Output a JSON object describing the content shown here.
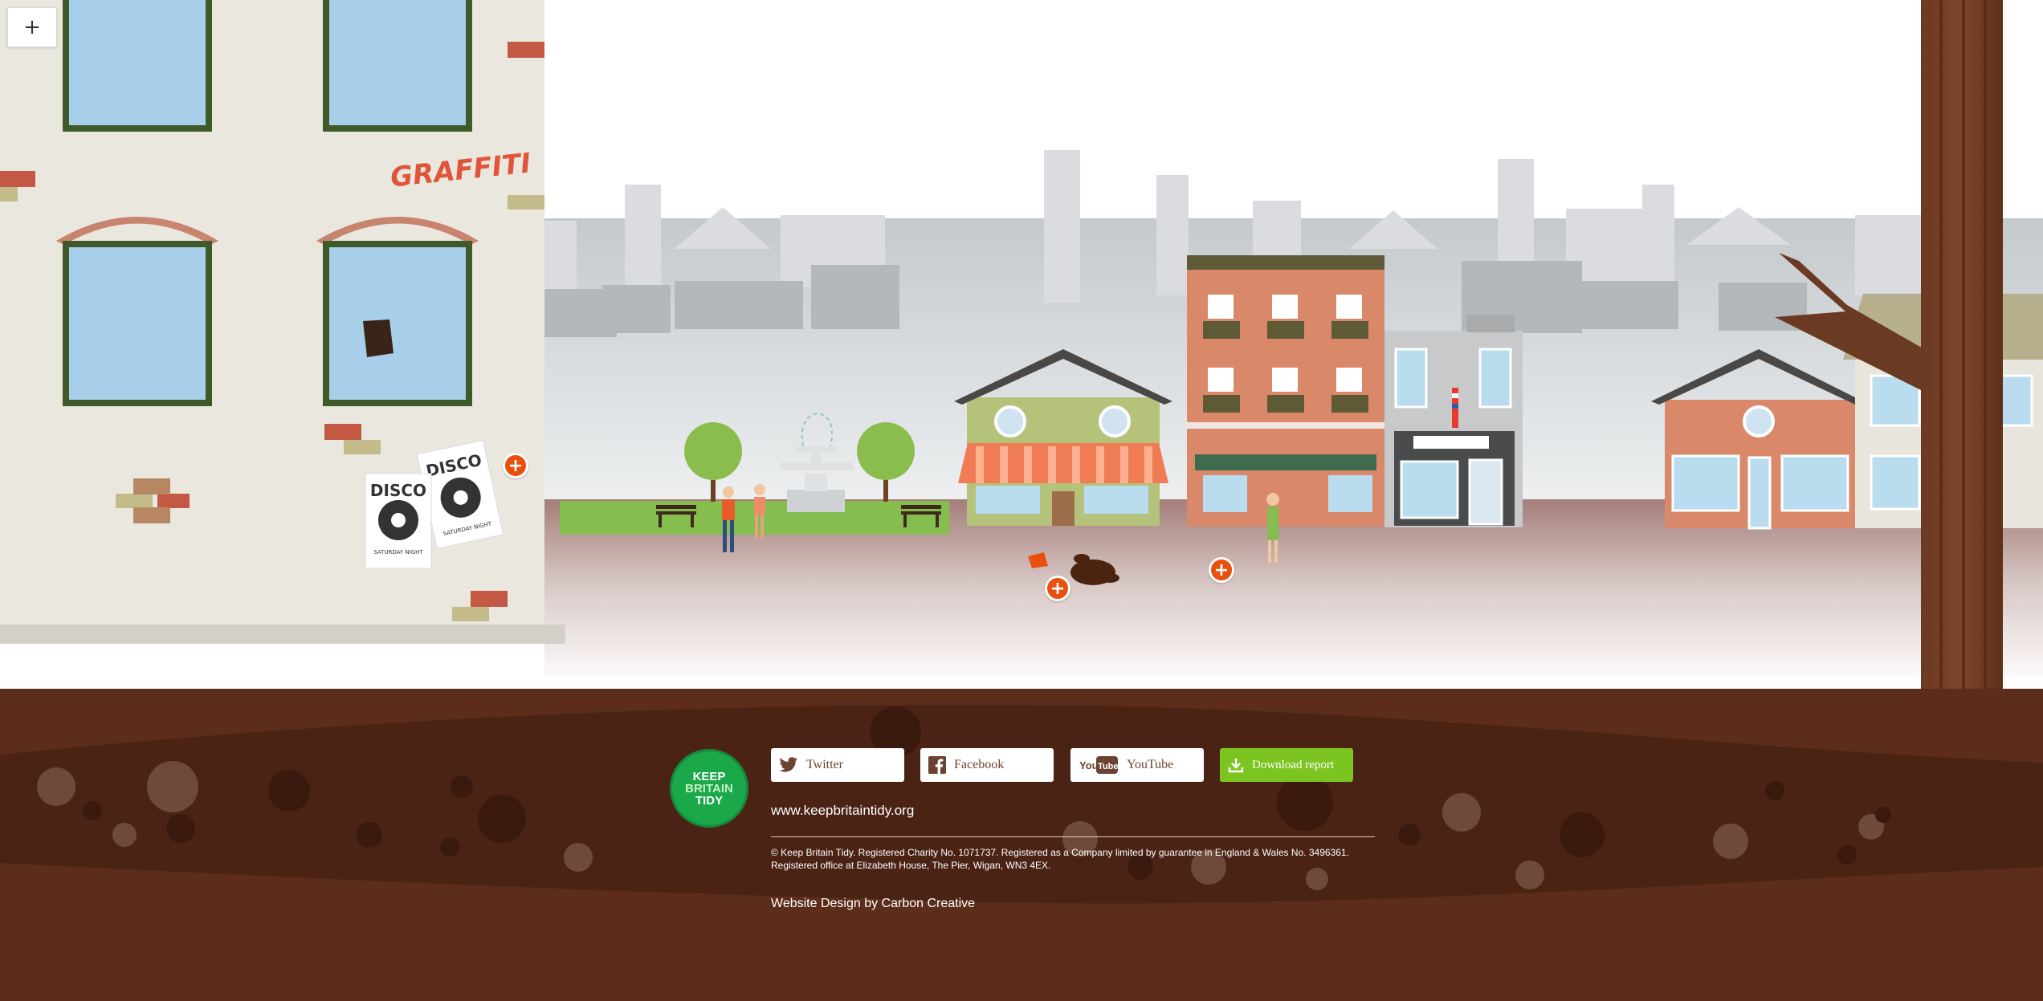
{
  "controls": {
    "zoom_label": "+"
  },
  "hotspots": {
    "label": "+"
  },
  "scene": {
    "graffiti_text": "GRAFFITI",
    "poster_front": {
      "title": "DISCO",
      "subtitle": "SATURDAY NIGHT"
    },
    "poster_back": {
      "title": "DISCO",
      "subtitle": "SATURDAY NIGHT"
    }
  },
  "footer": {
    "logo": {
      "line1": "KEEP",
      "line2": "BRITAIN",
      "line3": "TIDY"
    },
    "twitter_label": "Twitter",
    "facebook_label": "Facebook",
    "youtube_label": "YouTube",
    "youtube_badge": "You",
    "download_label": "Download report",
    "website": "www.keepbritaintidy.org",
    "legal_line1": "© Keep Britain Tidy. Registered Charity No. 1071737. Registered as a Company limited by guarantee in England & Wales No. 3496361.",
    "legal_line2": "Registered office at Elizabeth House, The Pier, Wigan, WN3 4EX.",
    "credit": "Website Design by Carbon Creative"
  },
  "colors": {
    "soil": "#5b2d1a",
    "soil_dark": "#4a2314",
    "brand_green": "#1aa84b",
    "download_green": "#7cc521",
    "hotspot_orange": "#e8500f",
    "pavement": "#a98883"
  }
}
